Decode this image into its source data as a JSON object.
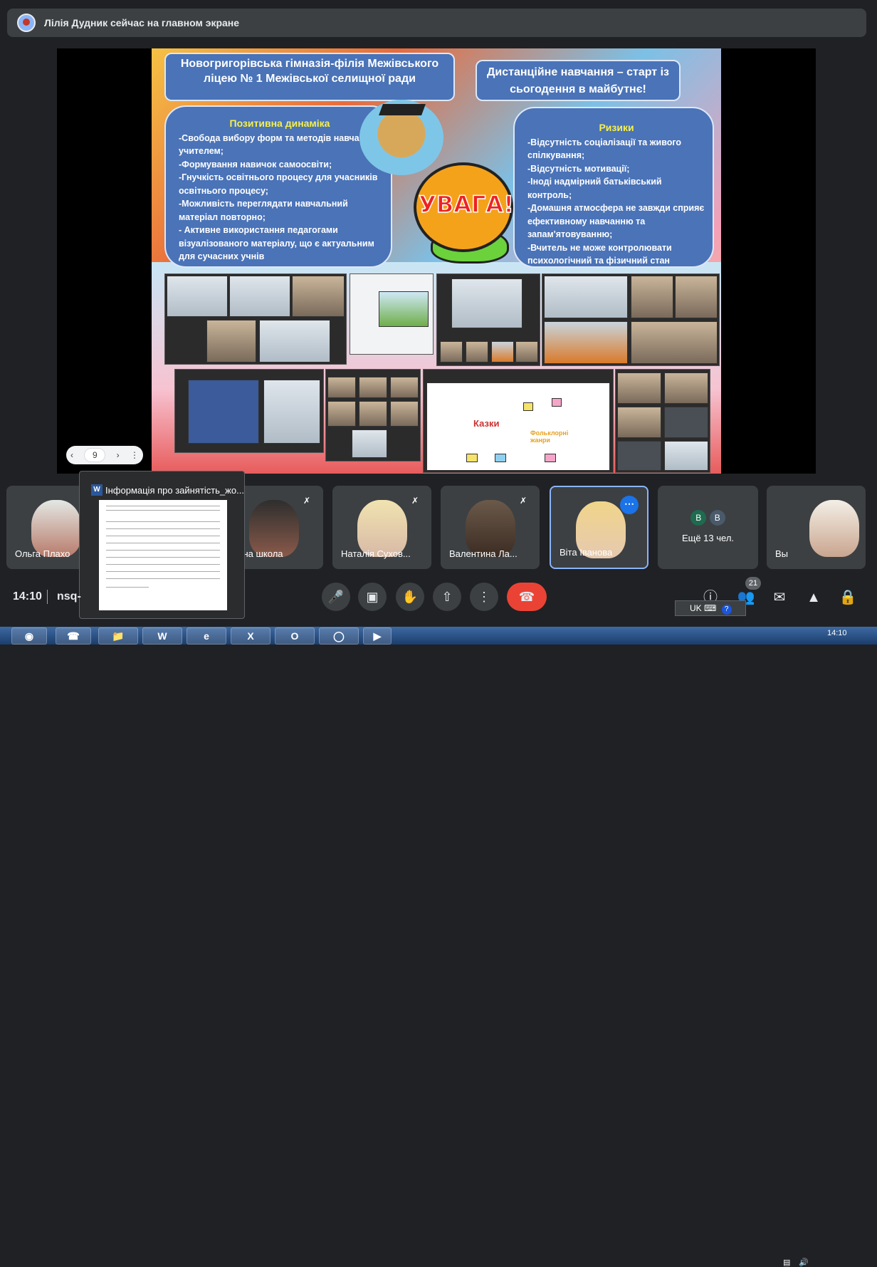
{
  "topbar": {
    "presenter_notice": "Лілія Дудник сейчас на главном экране"
  },
  "slide": {
    "title": "Новогригорівська гімназія-філія Межівського ліцею № 1 Межівської селищної ради",
    "motto": "Дистанційне навчання – старт із сьогодення в майбутнє!",
    "positive": {
      "heading": "Позитивна динаміка",
      "items": [
        "-Свобода вибору форм та методів навчання учителем;",
        "-Формування навичок самоосвіти;",
        "-Гнучкість освітнього процесу для учасників освітнього процесу;",
        "-Можливість переглядати навчальний матеріал повторно;",
        "- Активне використання педагогами візуалізованого матеріалу, що є актуальним для сучасних учнів"
      ]
    },
    "risks": {
      "heading": "Ризики",
      "items": [
        "-Відсутність соціалізації та живого спілкування;",
        "-Відсутність мотивації;",
        "-Іноді надмірний батьківський контроль;",
        "-Домашня атмосфера не завжди сприяє ефективному навчанню та запам'ятовуванню;",
        "-Вчитель не може контролювати психологічний та фізичний стан"
      ]
    },
    "warning": "УВАГА!",
    "mindmap_words": [
      "Казки",
      "Фольклорні жанри"
    ]
  },
  "pager": {
    "page": "9",
    "prev_icon": "chevron-left-icon",
    "next_icon": "chevron-right-icon",
    "menu_icon": "more-vert-icon"
  },
  "participants": [
    {
      "name": "Ольга Плахо",
      "muted": false
    },
    {
      "name": "орна школа",
      "muted": true
    },
    {
      "name": "Наталія Сухов...",
      "muted": true
    },
    {
      "name": "Валентина Ла...",
      "muted": true
    },
    {
      "name": "Віта Іванова",
      "muted": false
    },
    {
      "name": "Вы",
      "muted": false
    }
  ],
  "others": {
    "initials": [
      "В",
      "В"
    ],
    "label": "Ещё 13 чел."
  },
  "preview": {
    "title": "Інформація про зайнятість_жо..."
  },
  "bottom": {
    "time": "14:10",
    "meeting_code": "nsq-",
    "participant_count": "21"
  },
  "tray": {
    "lang": "UK",
    "time": "14:10"
  },
  "colors": {
    "end_call": "#ea4335",
    "accent": "#8ab4f8",
    "slide_box": "#4a73b8"
  }
}
